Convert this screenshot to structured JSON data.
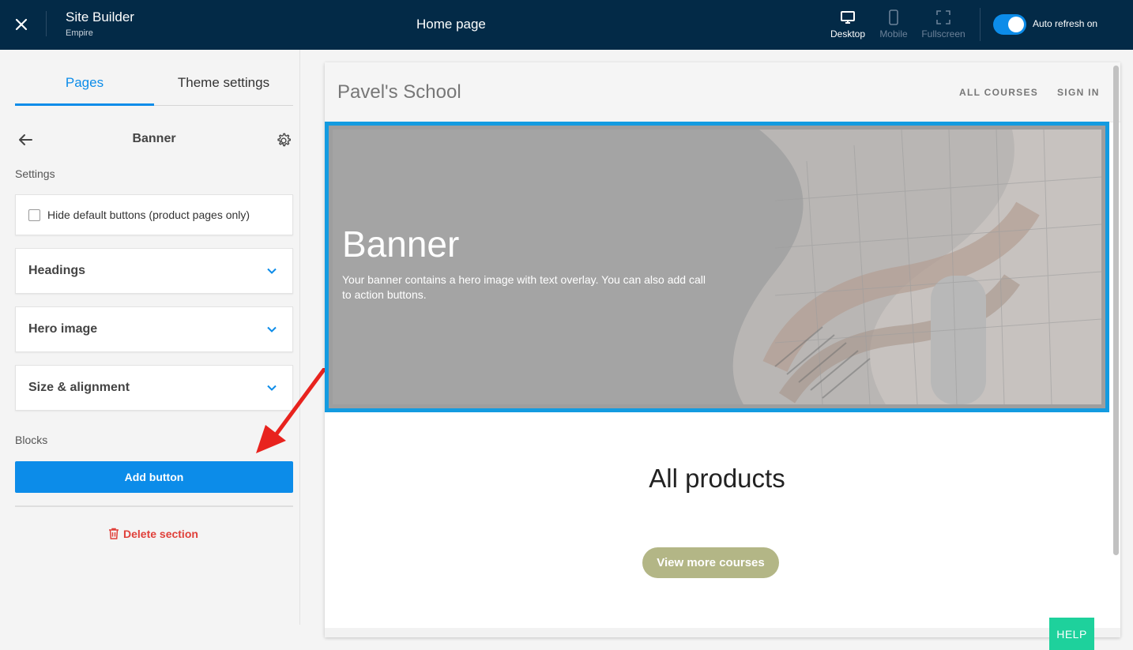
{
  "topbar": {
    "app_title": "Site Builder",
    "app_subtitle": "Empire",
    "page_name": "Home page",
    "devices": [
      {
        "label": "Desktop",
        "icon": "desktop-icon",
        "active": true
      },
      {
        "label": "Mobile",
        "icon": "mobile-icon",
        "active": false
      },
      {
        "label": "Fullscreen",
        "icon": "fullscreen-icon",
        "active": false
      }
    ],
    "auto_refresh_label": "Auto refresh on",
    "auto_refresh_on": true
  },
  "sidebar": {
    "tabs": [
      {
        "label": "Pages",
        "active": true
      },
      {
        "label": "Theme settings",
        "active": false
      }
    ],
    "section_title": "Banner",
    "settings_label": "Settings",
    "checkbox_label": "Hide default buttons (product pages only)",
    "checkbox_checked": false,
    "accordions": [
      {
        "label": "Headings"
      },
      {
        "label": "Hero image"
      },
      {
        "label": "Size & alignment"
      }
    ],
    "blocks_label": "Blocks",
    "add_button_label": "Add button",
    "delete_label": "Delete section"
  },
  "preview": {
    "site_name": "Pavel's School",
    "nav": [
      "ALL COURSES",
      "SIGN IN"
    ],
    "banner_title": "Banner",
    "banner_text": "Your banner contains a hero image with text overlay. You can also add call to action buttons.",
    "products_title": "All products",
    "more_button": "View more courses"
  },
  "help_label": "HELP",
  "colors": {
    "topbar": "#032a47",
    "accent": "#0c8ce9",
    "banner_border": "#139be0",
    "delete": "#e0403a",
    "more_button": "#b3b686",
    "help": "#1ed19c",
    "annotation_arrow": "#e8231e"
  }
}
